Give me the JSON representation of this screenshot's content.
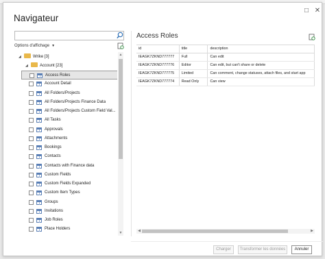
{
  "window": {
    "title": "Navigateur",
    "minimize_icon": "square-icon",
    "close_icon": "close-icon"
  },
  "left": {
    "search_value": "",
    "options_label": "Options d'affichage",
    "tree": {
      "root": {
        "label": "Wrike [3]"
      },
      "child": {
        "label": "Account [23]"
      },
      "items": [
        "Access Roles",
        "Account Detail",
        "All Folders/Projects",
        "All Folders/Projects Finance Data",
        "All Folders/Projects Custom Field Val...",
        "All Tasks",
        "Approvals",
        "Attachments",
        "Bookings",
        "Contacts",
        "Contacts with Finance data",
        "Custom Fields",
        "Custom Fields Expanded",
        "Custom Item Types",
        "Groups",
        "Invitations",
        "Job Roles",
        "Place Holders"
      ],
      "selected_index": 0
    }
  },
  "right": {
    "title": "Access Roles",
    "columns": [
      "id",
      "title",
      "description"
    ],
    "rows": [
      [
        "IEAGK7ZKND777777",
        "Full",
        "Can edit"
      ],
      [
        "IEAGK7ZKND777776",
        "Editor",
        "Can edit, but can't share or delete"
      ],
      [
        "IEAGK7ZKND777775",
        "Limited",
        "Can comment, change statuses, attach files, and start app"
      ],
      [
        "IEAGK7ZKND777774",
        "Read Only",
        "Can view"
      ]
    ]
  },
  "footer": {
    "load_label": "Charger",
    "transform_label": "Transformer les données",
    "cancel_label": "Annuler"
  },
  "colors": {
    "folder": "#e9b84a",
    "table_icon": "#5a7fb5",
    "selection": "#e6e6e6"
  }
}
